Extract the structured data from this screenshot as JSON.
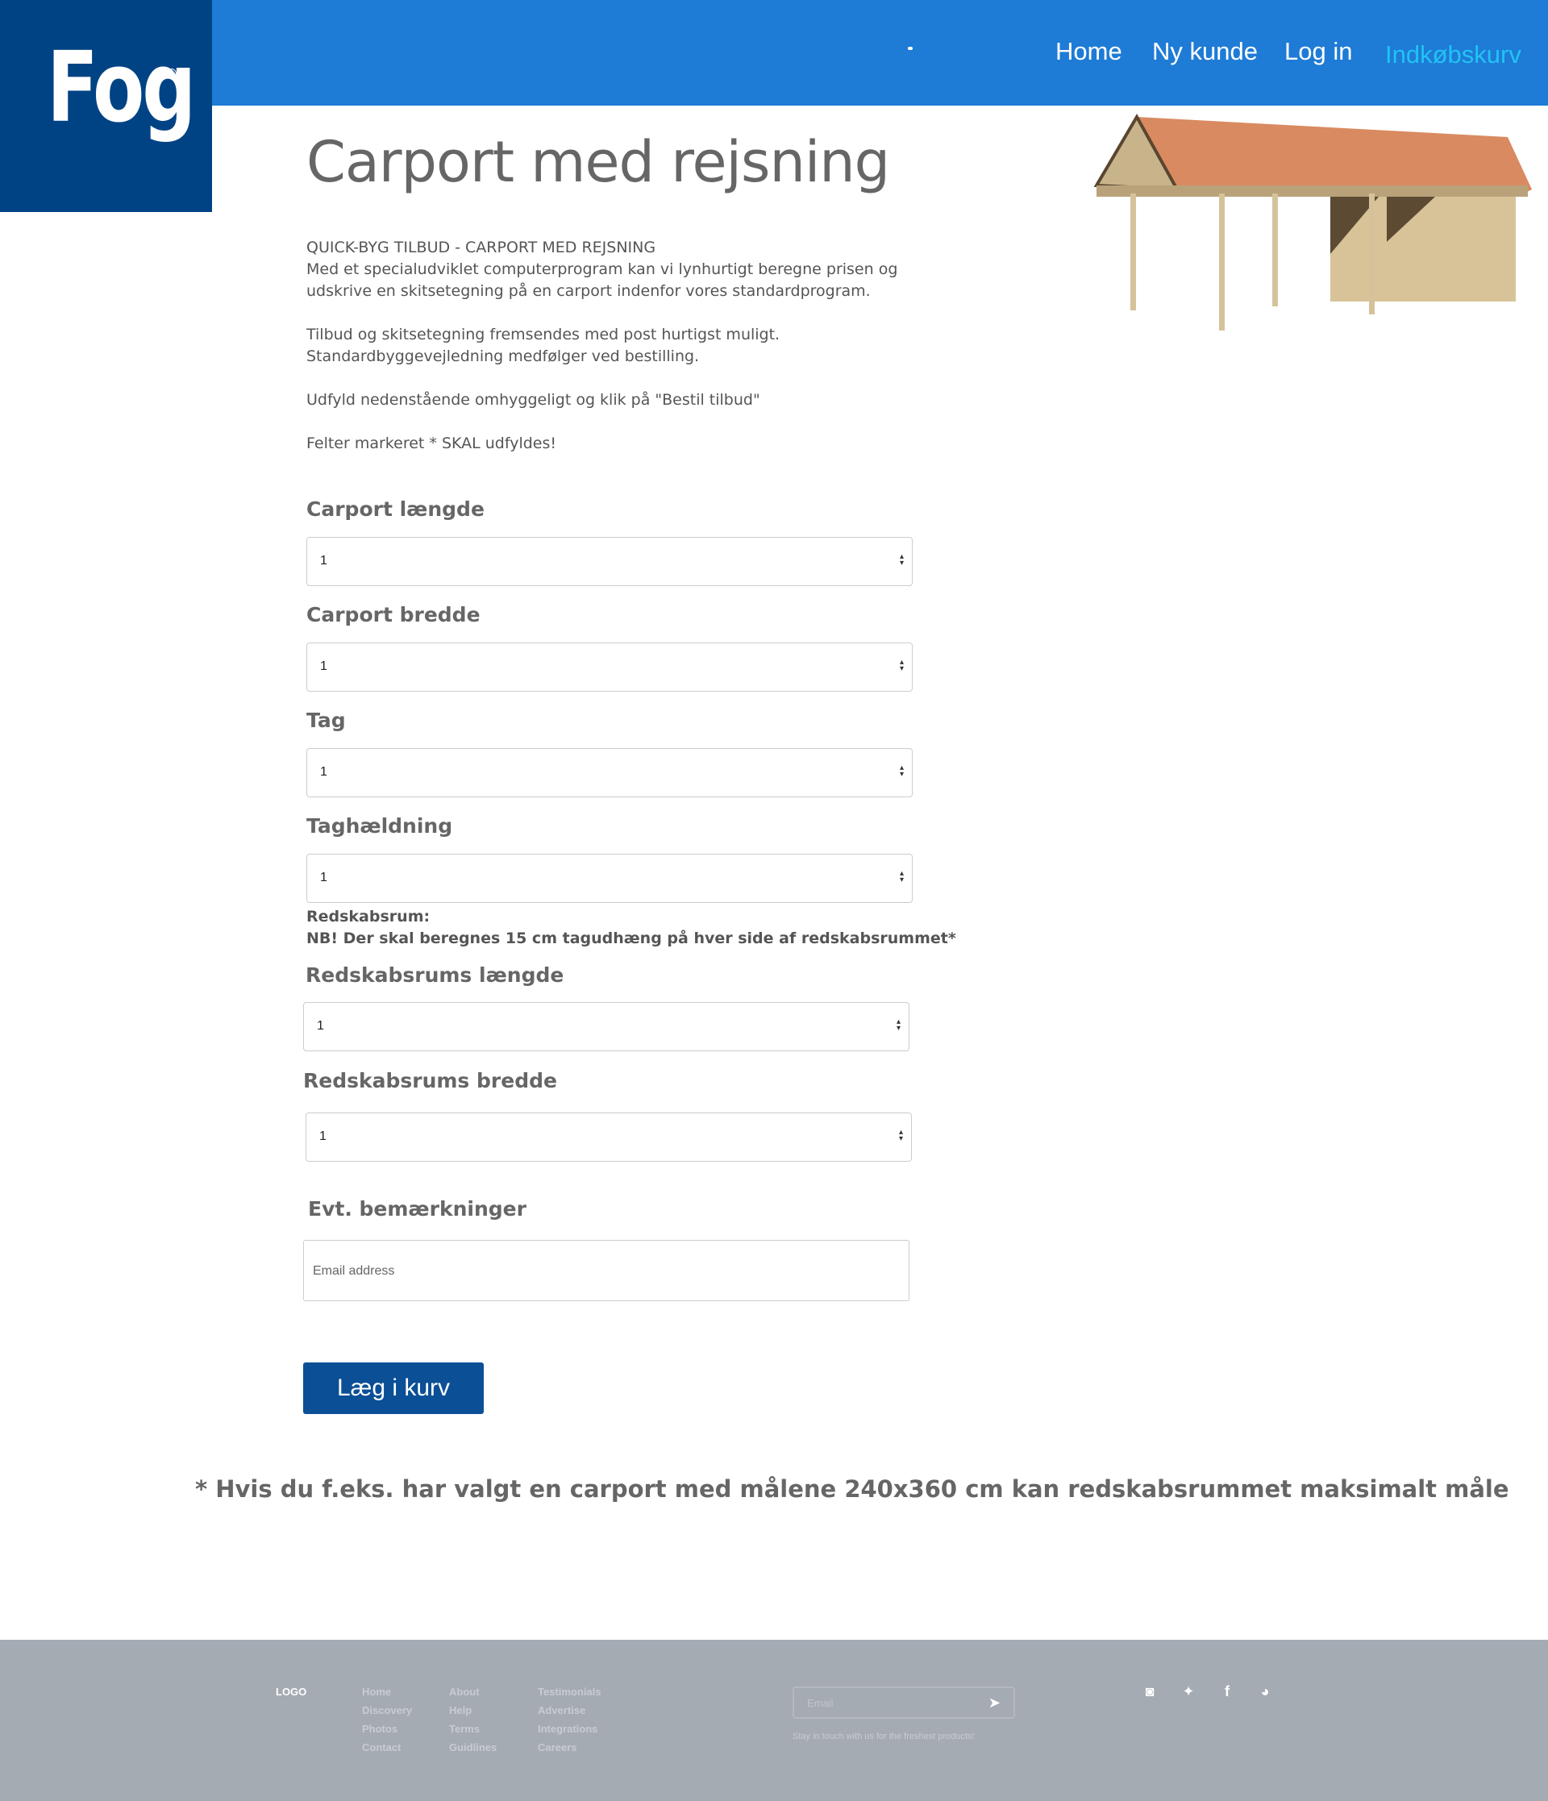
{
  "header": {
    "logo_text": "Fog",
    "logo_mark": "®",
    "nav": [
      {
        "label": "Home"
      },
      {
        "label": "Ny kunde"
      },
      {
        "label": "Log in"
      },
      {
        "label": "Indkøbskurv",
        "color": "#21c3f3"
      }
    ],
    "brand_color": "#1e7bd6",
    "logo_bg": "#004384"
  },
  "main": {
    "title": "Carport med rejsning",
    "intro": [
      "QUICK-BYG TILBUD - CARPORT MED REJSNING",
      "Med et specialudviklet computerprogram kan vi lynhurtigt beregne prisen og udskrive en skitsetegning på en carport indenfor vores standardprogram.",
      "Tilbud og skitsetegning fremsendes med post hurtigst muligt.",
      "Standardbyggevejledning medfølger ved bestilling.",
      "Udfyld nedenstående omhyggeligt og klik på \"Bestil tilbud\"",
      "Felter markeret * SKAL udfyldes!"
    ],
    "fields": [
      {
        "label": "Carport længde",
        "value": "1"
      },
      {
        "label": "Carport bredde",
        "value": "1"
      },
      {
        "label": "Tag",
        "value": "1"
      },
      {
        "label": "Taghældning",
        "value": "1"
      },
      {
        "label": "Redskabsrums længde",
        "value": "1"
      },
      {
        "label": "Redskabsrums bredde",
        "value": "1"
      }
    ],
    "shed_heading": "Redskabsrum:",
    "shed_note": "NB! Der skal beregnes 15 cm tagudhæng på hver side af redskabsrummet*",
    "remarks_label": "Evt. bemærkninger",
    "remarks_placeholder": "Email address",
    "submit_label": "Læg i kurv",
    "footnote": "* Hvis du f.eks. har valgt en carport med målene 240x360 cm kan redskabsrummet maksimalt måle"
  },
  "footer": {
    "logo": "LOGO",
    "columns": [
      [
        "Home",
        "Discovery",
        "Photos",
        "Contact"
      ],
      [
        "About",
        "Help",
        "Terms",
        "Guidlines"
      ],
      [
        "Testimonials",
        "Advertise",
        "Integrations",
        "Careers"
      ]
    ],
    "email_placeholder": "Email",
    "tagline": "Stay in touch with us for the freshest products!",
    "social_icons": [
      "instagram-icon",
      "twitter-icon",
      "facebook-icon",
      "globe-icon"
    ]
  }
}
